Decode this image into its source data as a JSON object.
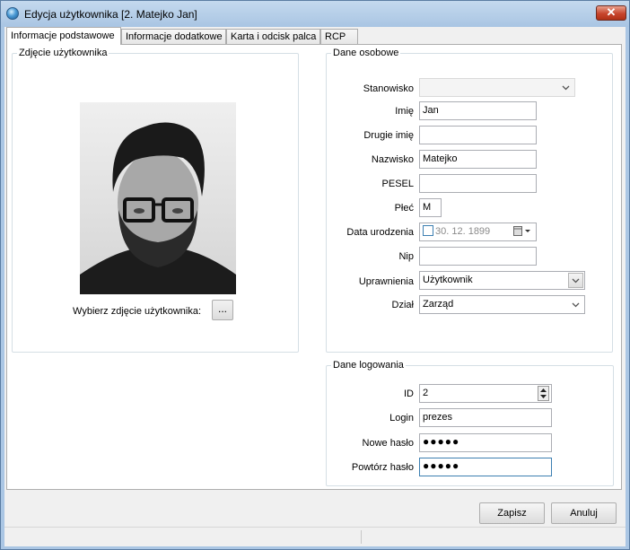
{
  "window": {
    "title": "Edycja użytkownika [2. Matejko Jan]"
  },
  "tabs": [
    "Informacje podstawowe",
    "Informacje dodatkowe",
    "Karta i odcisk palca",
    "RCP"
  ],
  "photo_group": {
    "title": "Zdjęcie użytkownika",
    "choose_label": "Wybierz zdjęcie użytkownika:",
    "browse_label": "..."
  },
  "personal": {
    "title": "Dane osobowe",
    "position_label": "Stanowisko",
    "position_value": "",
    "first_name_label": "Imię",
    "first_name_value": "Jan",
    "second_name_label": "Drugie imię",
    "second_name_value": "",
    "last_name_label": "Nazwisko",
    "last_name_value": "Matejko",
    "pesel_label": "PESEL",
    "pesel_value": "",
    "sex_label": "Płeć",
    "sex_value": "M",
    "birth_label": "Data urodzenia",
    "birth_value": "30. 12. 1899",
    "nip_label": "Nip",
    "nip_value": "",
    "permissions_label": "Uprawnienia",
    "permissions_value": "Użytkownik",
    "department_label": "Dział",
    "department_value": "Zarząd"
  },
  "login": {
    "title": "Dane logowania",
    "id_label": "ID",
    "id_value": "2",
    "login_label": "Login",
    "login_value": "prezes",
    "new_password_label": "Nowe hasło",
    "new_password_value": "●●●●●",
    "repeat_password_label": "Powtórz hasło",
    "repeat_password_value": "●●●●●"
  },
  "buttons": {
    "save": "Zapisz",
    "cancel": "Anuluj"
  },
  "colors": {
    "titlebar": "#aac6e4",
    "close": "#c7452c",
    "focus_border": "#3c7fb1"
  }
}
